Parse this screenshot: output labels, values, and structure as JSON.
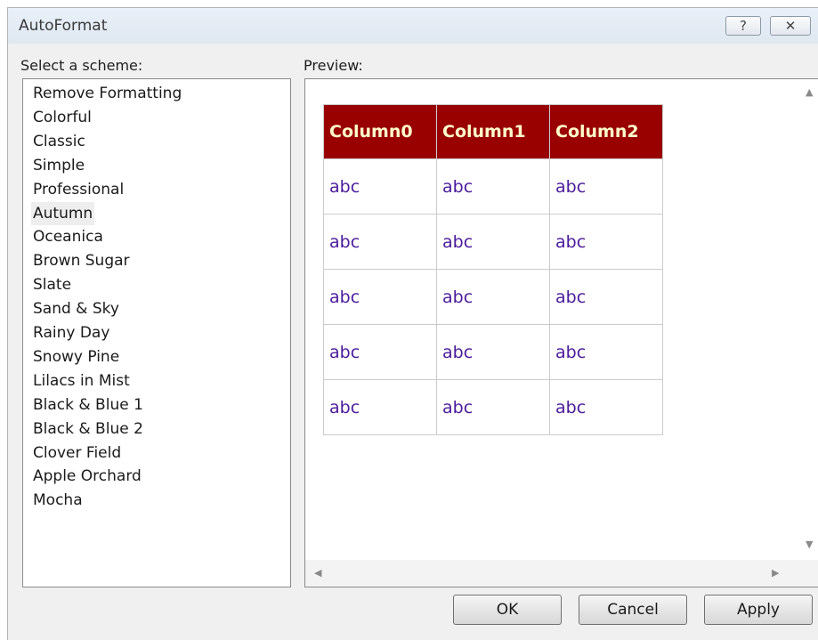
{
  "window": {
    "title": "AutoFormat",
    "help_glyph": "?",
    "close_glyph": "✕"
  },
  "scheme_label": "Select a scheme:",
  "preview_label": "Preview:",
  "schemes": [
    "Remove Formatting",
    "Colorful",
    "Classic",
    "Simple",
    "Professional",
    "Autumn",
    "Oceanica",
    "Brown Sugar",
    "Slate",
    "Sand & Sky",
    "Rainy Day",
    "Snowy Pine",
    "Lilacs in Mist",
    "Black & Blue 1",
    "Black & Blue 2",
    "Clover Field",
    "Apple Orchard",
    "Mocha"
  ],
  "selected_scheme": "Autumn",
  "preview_table": {
    "headers": [
      "Column0",
      "Column1",
      "Column2"
    ],
    "rows": [
      [
        "abc",
        "abc",
        "abc"
      ],
      [
        "abc",
        "abc",
        "abc"
      ],
      [
        "abc",
        "abc",
        "abc"
      ],
      [
        "abc",
        "abc",
        "abc"
      ],
      [
        "abc",
        "abc",
        "abc"
      ]
    ],
    "header_bg": "#990000",
    "header_fg": "#ffffcc",
    "cell_fg": "#4b1b9c"
  },
  "buttons": {
    "ok": "OK",
    "cancel": "Cancel",
    "apply": "Apply"
  },
  "icons": {
    "scroll_up": "▲",
    "scroll_down": "▼",
    "scroll_left": "◀",
    "scroll_right": "▶"
  }
}
